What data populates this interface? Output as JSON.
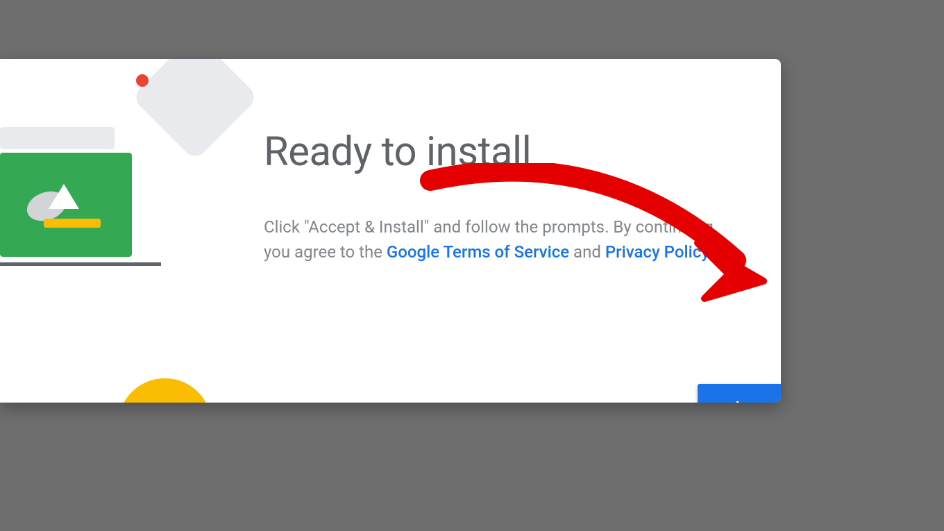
{
  "dialog": {
    "title": "Ready to install",
    "body_prefix": "Click \"Accept & Install\" and follow the prompts. By continuing, you agree to the ",
    "tos_link": "Google Terms of Service",
    "and_text": " and ",
    "privacy_link": "Privacy Policy",
    "body_suffix": ".",
    "accept_button": "Accept & Install"
  },
  "colors": {
    "primary": "#1a73e8",
    "green": "#34a853",
    "yellow": "#fbbc04",
    "red": "#ea4335",
    "gray": "#5f6368"
  }
}
